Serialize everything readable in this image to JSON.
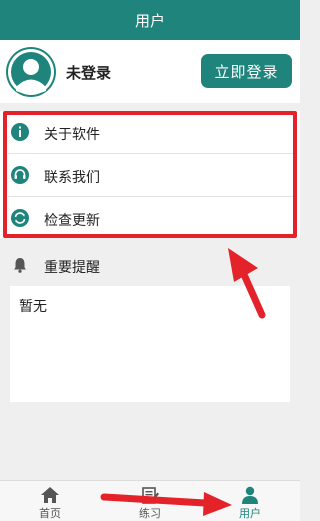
{
  "header": {
    "title": "用户"
  },
  "user": {
    "name": "未登录",
    "login_label": "立即登录"
  },
  "menu": {
    "items": [
      {
        "label": "关于软件",
        "icon": "info-icon"
      },
      {
        "label": "联系我们",
        "icon": "headset-icon"
      },
      {
        "label": "检查更新",
        "icon": "refresh-icon"
      }
    ]
  },
  "notice": {
    "title": "重要提醒",
    "content": "暂无",
    "icon": "bell-icon"
  },
  "tabbar": {
    "items": [
      {
        "label": "首页",
        "icon": "home-icon"
      },
      {
        "label": "练习",
        "icon": "edit-icon"
      },
      {
        "label": "用户",
        "icon": "user-icon",
        "active": true
      }
    ]
  },
  "colors": {
    "accent": "#1f857c",
    "highlight": "#e42229"
  }
}
